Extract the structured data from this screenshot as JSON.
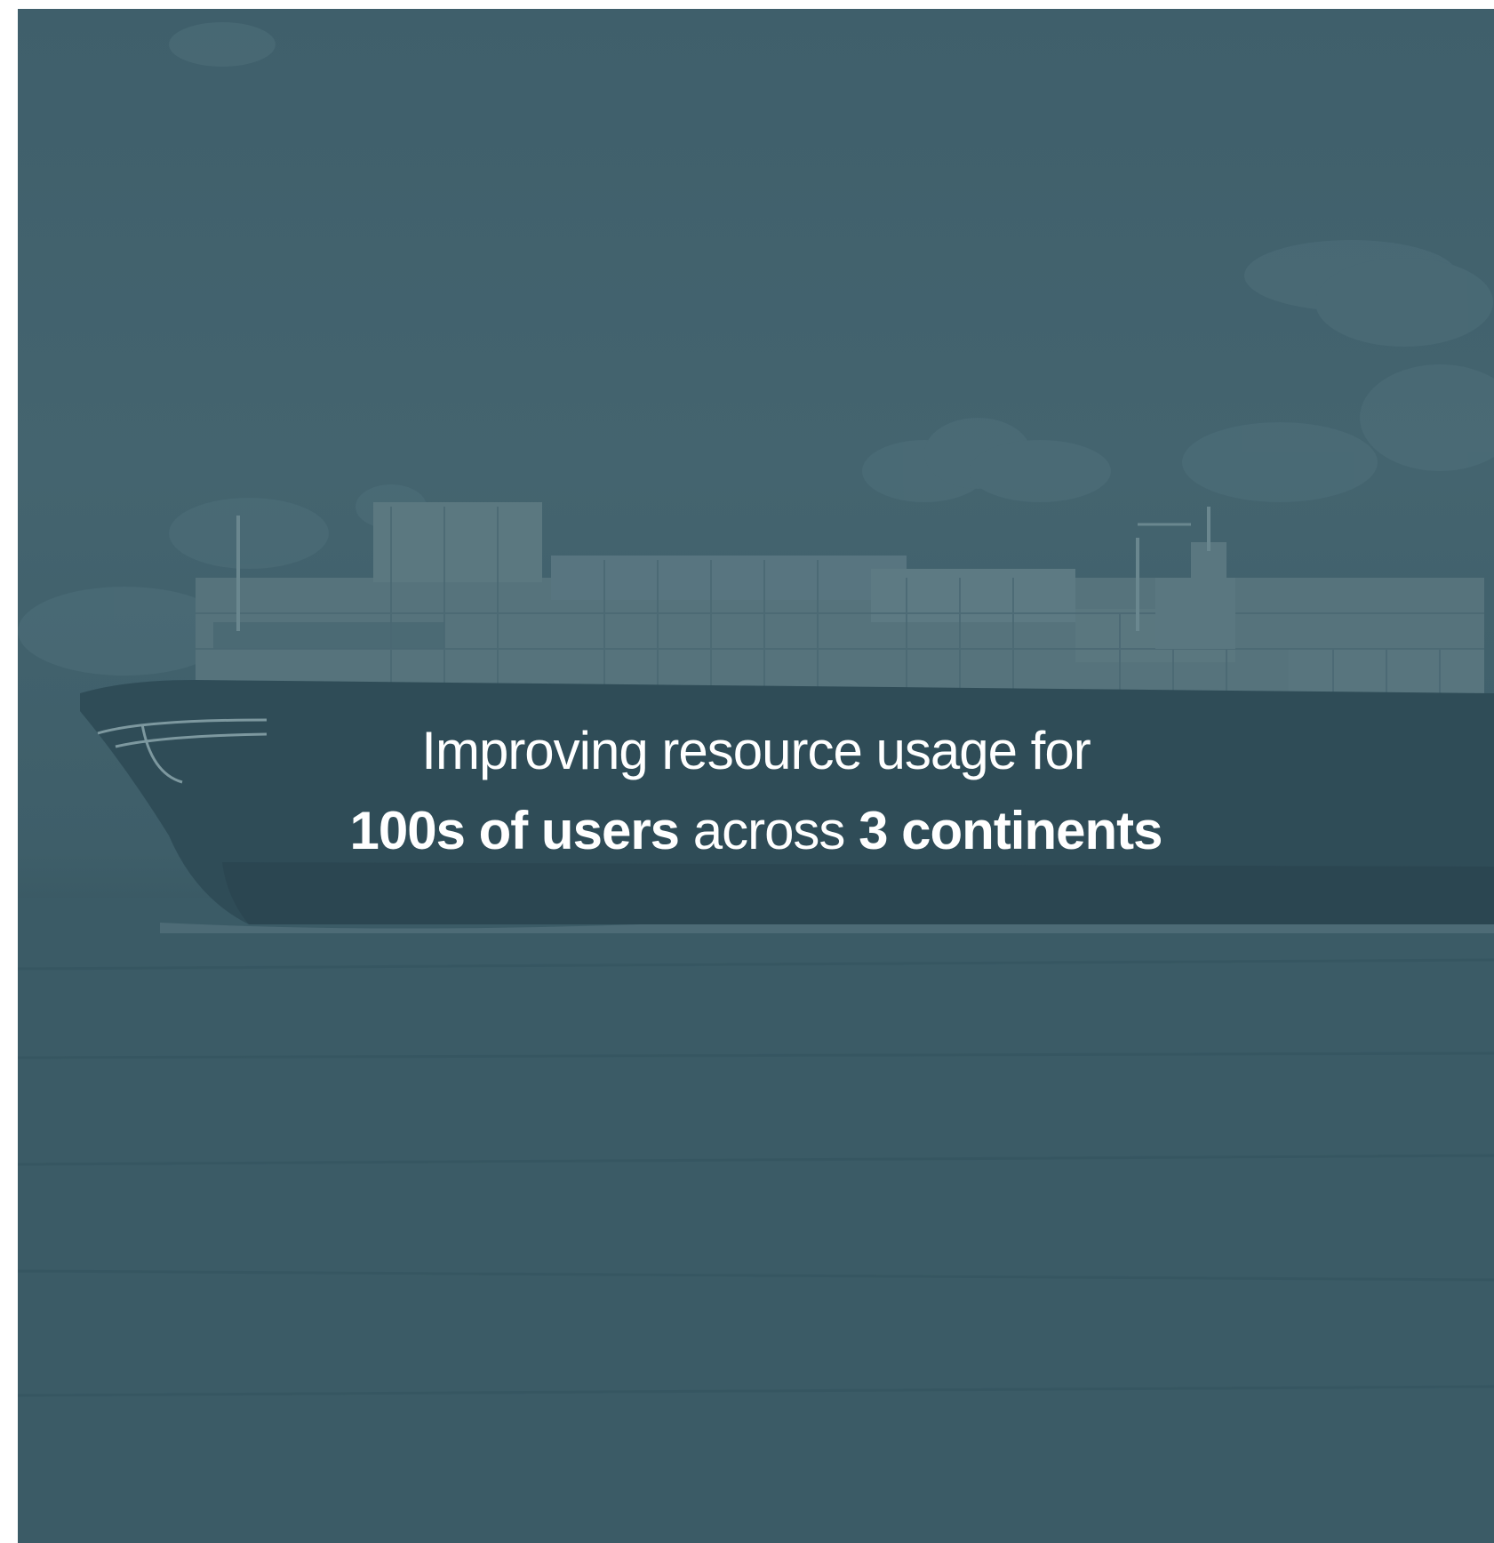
{
  "hero": {
    "headline_line1": "Improving resource usage for",
    "headline_line2_bold1": "100s of users",
    "headline_line2_light": " across ",
    "headline_line2_bold2": "3 continents"
  },
  "scene": {
    "subject": "container-ship-icon",
    "overlay_color": "#3f5f6b",
    "water_color": "#3a5a65",
    "text_color": "#ffffff"
  }
}
